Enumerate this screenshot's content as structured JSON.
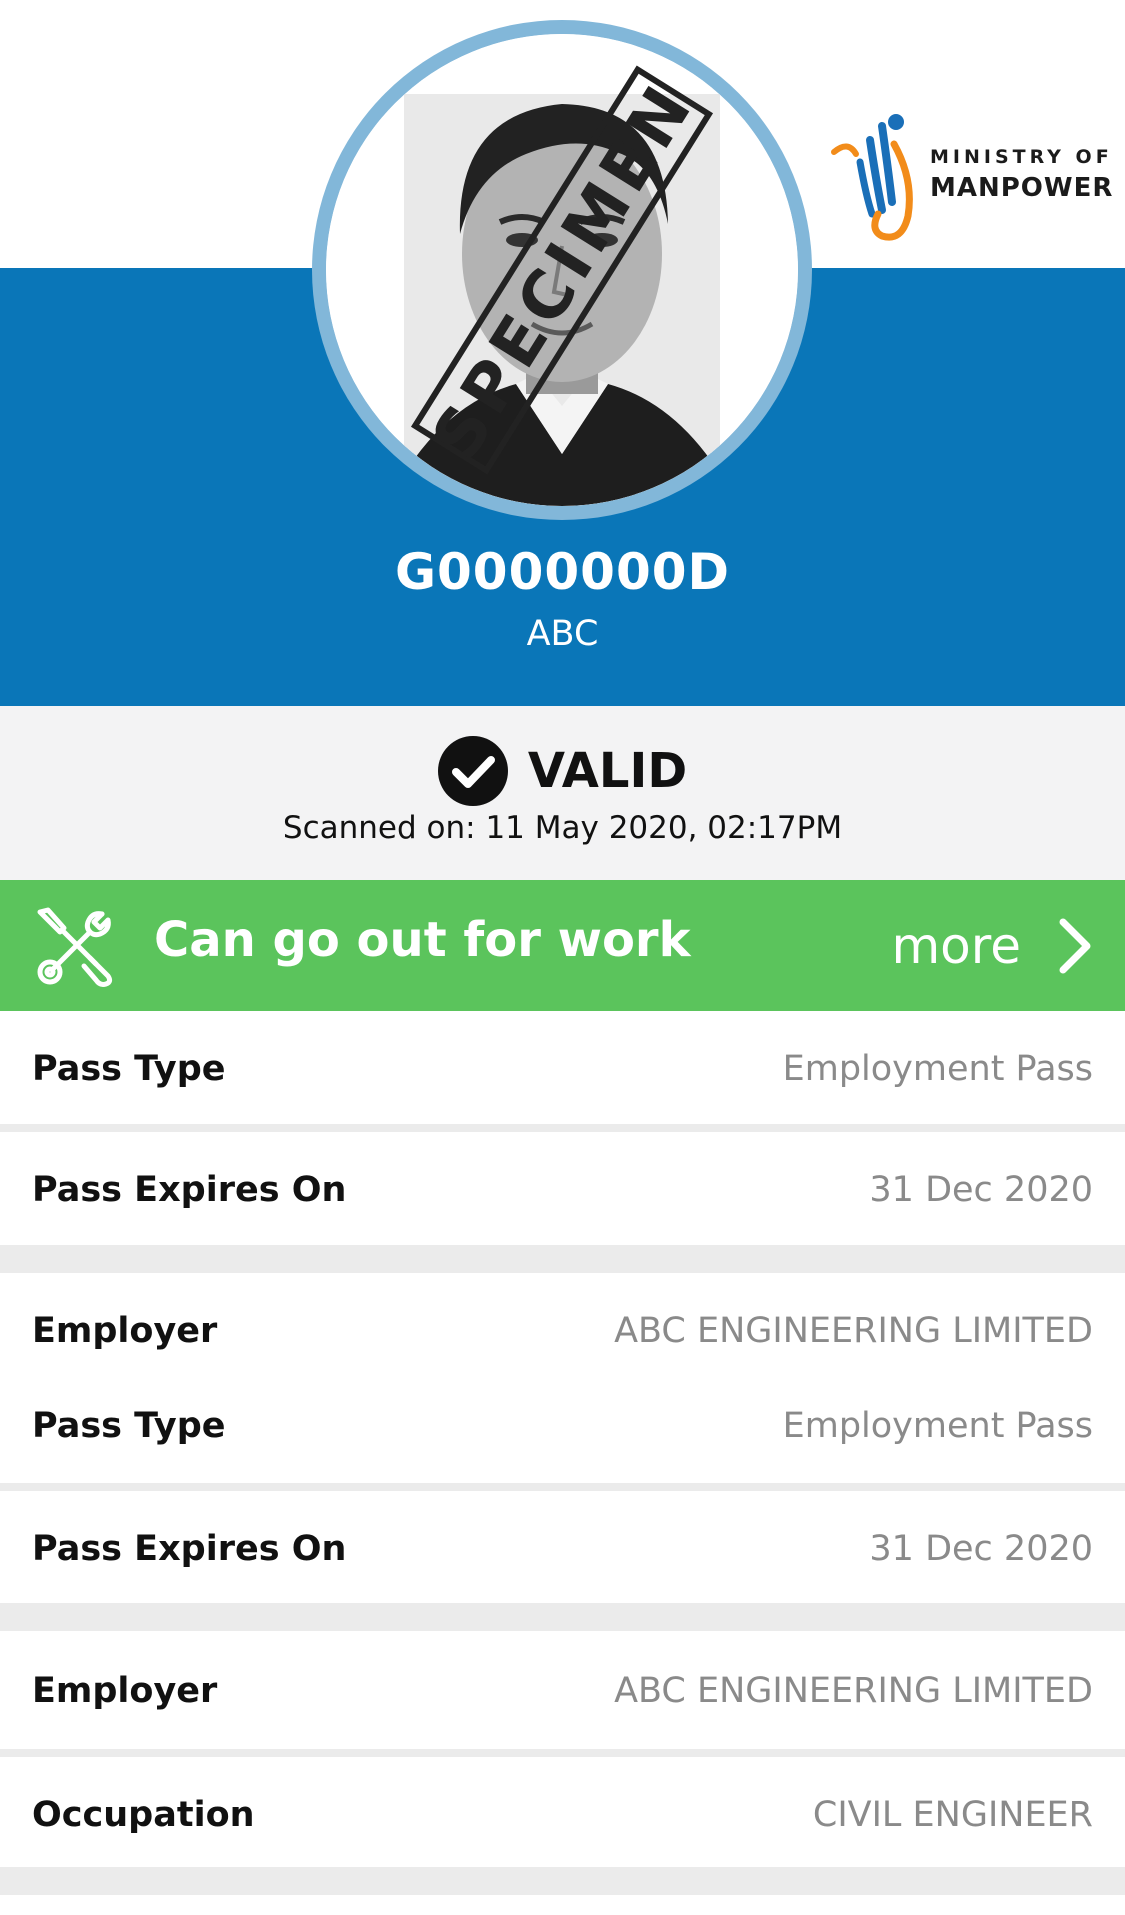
{
  "header": {
    "pass_number": "G0000000D",
    "holder_name": "ABC",
    "photo_watermark": "SPECIMEN",
    "logo": {
      "line1": "MINISTRY OF",
      "line2": "MANPOWER"
    }
  },
  "status": {
    "label": "VALID",
    "scanned_text": "Scanned on: 11 May 2020, 02:17PM"
  },
  "banner": {
    "text": "Can go out for work",
    "more_label": "more",
    "color": "#5bc45c"
  },
  "colors": {
    "brand_blue": "#0a76b8",
    "ring": "#82b7d9",
    "status_bg": "#f3f3f4"
  },
  "details": [
    {
      "label": "Pass Type",
      "value": "Employment Pass"
    },
    {
      "label": "Pass Expires On",
      "value": "31 Dec 2020"
    },
    {
      "label": "Employer",
      "value": "ABC ENGINEERING LIMITED"
    },
    {
      "label": "Pass Type",
      "value": "Employment Pass"
    },
    {
      "label": "Pass Expires On",
      "value": "31 Dec 2020"
    },
    {
      "label": "Employer",
      "value": "ABC ENGINEERING LIMITED"
    },
    {
      "label": "Occupation",
      "value": "CIVIL ENGINEER"
    }
  ]
}
